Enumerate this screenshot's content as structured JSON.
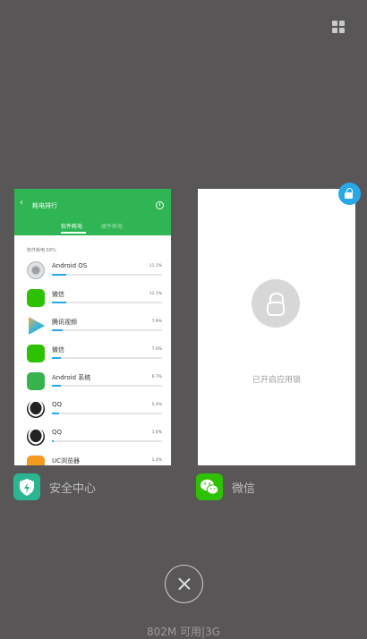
{
  "recents": {
    "cards": [
      {
        "app_name": "安全中心",
        "header_title": "耗电排行",
        "tabs": [
          "软件耗电",
          "硬件耗电"
        ],
        "summary": "软件耗电:58%",
        "rows": [
          {
            "name": "Android OS",
            "percent": "11.1%",
            "icon": "android-os-icon",
            "level": 0.11
          },
          {
            "name": "微信",
            "percent": "11.1%",
            "icon": "wechat-icon",
            "level": 0.11
          },
          {
            "name": "腾讯视频",
            "percent": "7.9%",
            "icon": "tencent-video-icon",
            "level": 0.079
          },
          {
            "name": "微信",
            "percent": "7.0%",
            "icon": "wechat-icon",
            "level": 0.07
          },
          {
            "name": "Android 系统",
            "percent": "6.7%",
            "icon": "android-system-icon",
            "level": 0.067
          },
          {
            "name": "QQ",
            "percent": "5.4%",
            "icon": "qq-icon",
            "level": 0.054
          },
          {
            "name": "QQ",
            "percent": "1.6%",
            "icon": "qq-icon",
            "level": 0.016
          },
          {
            "name": "UC浏览器",
            "percent": "1.4%",
            "icon": "uc-browser-icon",
            "level": 0.014
          }
        ]
      },
      {
        "app_name": "微信",
        "lock_message": "已开启应用锁"
      }
    ],
    "memory_status": "802M 可用|3G"
  },
  "colors": {
    "background": "#595657",
    "security_green": "#2fb553",
    "accent_blue": "#28a8e9",
    "wechat_green": "#2dc100"
  }
}
